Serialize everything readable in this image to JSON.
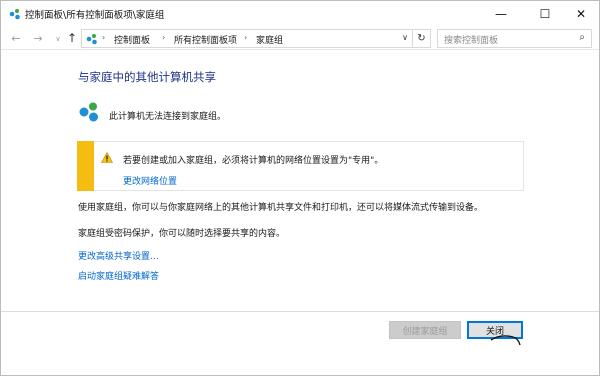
{
  "window": {
    "title": "控制面板\\所有控制面板项\\家庭组",
    "minimize_glyph": "—",
    "maximize_glyph": "☐",
    "close_glyph": "✕"
  },
  "nav": {
    "back_glyph": "←",
    "forward_glyph": "→",
    "recent_glyph": "∨",
    "up_glyph": "↑",
    "crumbs": [
      "控制面板",
      "所有控制面板项",
      "家庭组"
    ],
    "crumb_sep": "›",
    "dropdown_glyph": "∨",
    "refresh_glyph": "↻",
    "search_placeholder": "搜索控制面板",
    "search_glyph": "⌕"
  },
  "content": {
    "heading": "与家庭中的其他计算机共享",
    "status": "此计算机无法连接到家庭组。",
    "warning": {
      "text": "若要创建或加入家庭组，必须将计算机的网络位置设置为\"专用\"。",
      "link": "更改网络位置",
      "accent_color": "#f5bd12"
    },
    "para1": "使用家庭组，你可以与你家庭网络上的其他计算机共享文件和打印机，还可以将媒体流式传输到设备。",
    "para2": "家庭组受密码保护，你可以随时选择要共享的内容。",
    "link_advanced": "更改高级共享设置...",
    "link_troubleshoot": "启动家庭组疑难解答"
  },
  "buttons": {
    "create": "创建家庭组",
    "close": "关闭"
  },
  "colors": {
    "heading": "#1e3287",
    "link": "#0066cc",
    "focus": "#0078d7"
  }
}
